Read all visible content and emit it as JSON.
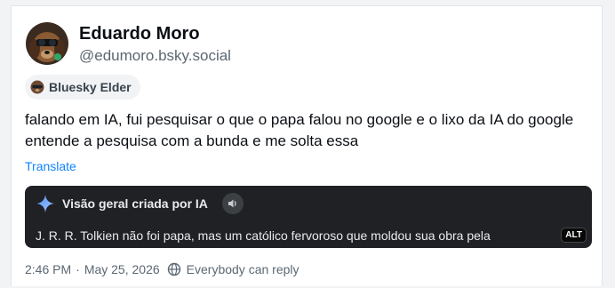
{
  "author": {
    "display_name": "Eduardo Moro",
    "handle": "@edumoro.bsky.social"
  },
  "badge": {
    "label": "Bluesky Elder",
    "icon": "sunglasses-butterfly-icon"
  },
  "post": {
    "text": "falando em IA, fui pesquisar o que o papa falou no google e o lixo da IA do google entende a pesquisa com a bunda e me solta essa",
    "translate_label": "Translate"
  },
  "image_embed": {
    "header": "Visão geral criada por IA",
    "summary": "J. R. R. Tolkien não foi papa, mas um católico fervoroso que moldou sua obra pela",
    "alt_badge": "ALT",
    "icons": [
      "gemini-sparkle-icon",
      "speaker-icon"
    ]
  },
  "meta": {
    "timestamp": "2:46 PM",
    "separator": "·",
    "date": "May 25, 2026",
    "reply_setting": "Everybody can reply",
    "reply_icon": "globe-icon"
  },
  "colors": {
    "link": "#1083fe",
    "muted": "#5b6773",
    "embed_bg": "#202124"
  }
}
